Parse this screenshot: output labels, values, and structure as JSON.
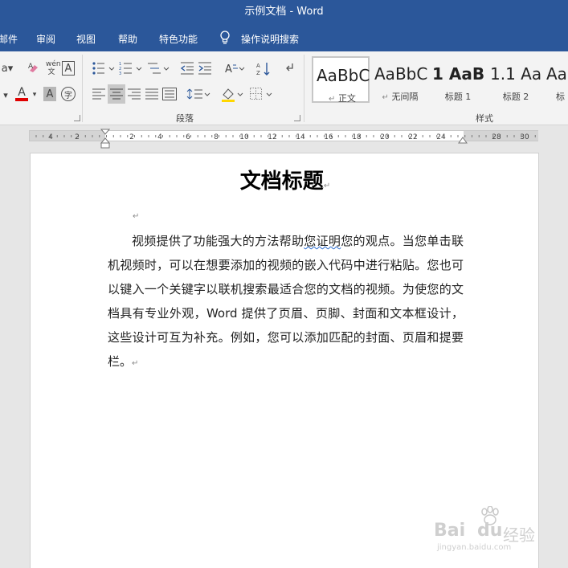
{
  "window": {
    "title": "示例文档  -  Word"
  },
  "menu": {
    "items": [
      "邮件",
      "审阅",
      "视图",
      "帮助",
      "特色功能"
    ],
    "tell_me": "操作说明搜索"
  },
  "ribbon": {
    "groups": {
      "paragraph": "段落",
      "styles": "样式"
    },
    "styles": [
      {
        "sample": "AaBbC",
        "name": "正文"
      },
      {
        "sample": "AaBbC",
        "name": "无间隔"
      },
      {
        "sample": "1 AaB",
        "name": "标题 1"
      },
      {
        "sample": "1.1 Aa",
        "name": "标题 2"
      },
      {
        "sample": "Aa",
        "name": "标"
      }
    ],
    "phonetic_label": "wén 文",
    "char_border_label": "A",
    "char_shading_label": "A",
    "enclosed_char_label": "字"
  },
  "ruler": {
    "labels": [
      "4",
      "2",
      "2",
      "4",
      "6",
      "8",
      "10",
      "12",
      "14",
      "16",
      "18",
      "20",
      "22",
      "24",
      "28",
      "30"
    ]
  },
  "document": {
    "title": "文档标题",
    "body_before_squiggle": "视频提供了功能强大的方法帮助",
    "squiggle_word": "您证明",
    "body_after_squiggle": "您的观点。当您单击联机视频时，可以在想要添加的视频的嵌入代码中进行粘贴。您也可以键入一个关键字以联机搜索最适合您的文档的视频。为使您的文档具有专业外观，Word 提供了页眉、页脚、封面和文本框设计，这些设计可互为补充。例如，您可以添加匹配的封面、页眉和提要栏。",
    "para_mark": "↵"
  },
  "watermark": {
    "brand": "Bai",
    "brand_suffix": "经验",
    "url": "jingyan.baidu.com"
  },
  "colors": {
    "accent": "#2b579a",
    "font_color_bar": "#e00000",
    "highlight_bar": "#ffd700"
  }
}
